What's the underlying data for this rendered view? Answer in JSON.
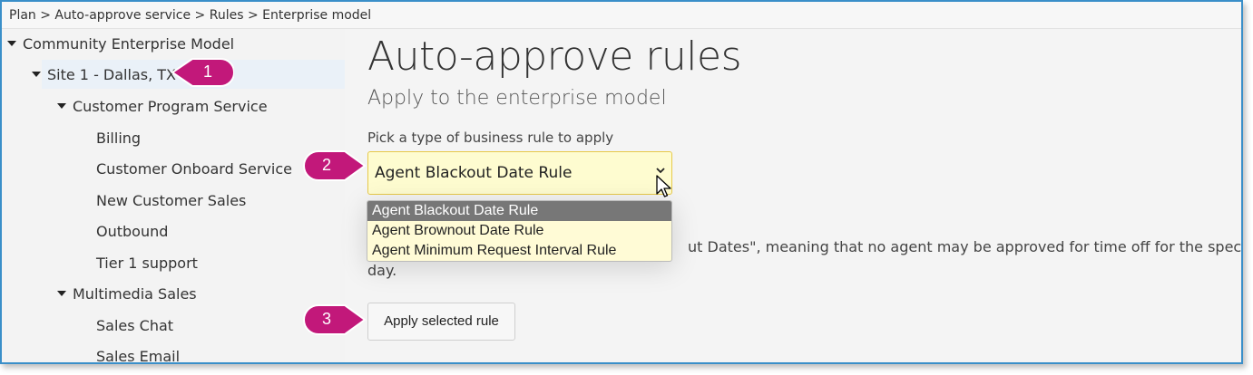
{
  "breadcrumb": "Plan > Auto-approve service > Rules > Enterprise model",
  "tree": {
    "root": "Community Enterprise Model",
    "site": "Site 1 - Dallas, TX",
    "customer_program": "Customer Program Service",
    "billing": "Billing",
    "customer_onboard": "Customer Onboard Service",
    "new_customer_sales": "New Customer Sales",
    "outbound": "Outbound",
    "tier1": "Tier 1 support",
    "multimedia_sales": "Multimedia Sales",
    "sales_chat": "Sales Chat",
    "sales_email": "Sales Email"
  },
  "main": {
    "title": "Auto-approve rules",
    "subtitle": "Apply to the enterprise model",
    "pick_label": "Pick a type of business rule to apply",
    "selected_rule": "Agent Blackout Date Rule",
    "options": [
      "Agent Blackout Date Rule",
      "Agent Brownout Date Rule",
      "Agent Minimum Request Interval Rule"
    ],
    "desc_line1": "ut Dates\", meaning that no agent may be approved for time off for the specific",
    "desc_line2": "day.",
    "apply_button": "Apply selected rule"
  },
  "callouts": [
    "1",
    "2",
    "3"
  ],
  "colors": {
    "accent_border": "#3a8fc9",
    "select_bg": "#fefcd0",
    "callout": "#c2187a"
  }
}
